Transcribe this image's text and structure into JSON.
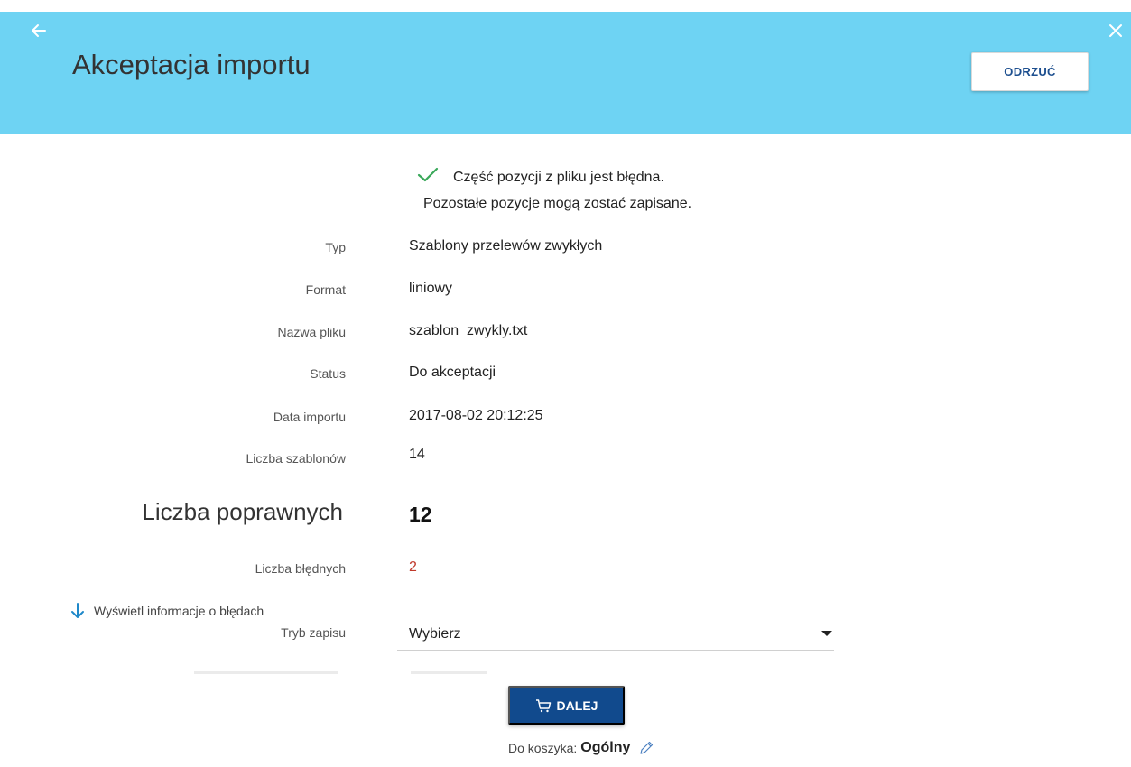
{
  "header": {
    "title": "Akceptacja importu",
    "reject_label": "ODRZUĆ",
    "accent": "#6ed3f3"
  },
  "notice": {
    "line1": "Część pozycji z pliku jest błędna.",
    "line2": "Pozostałe pozycje mogą zostać zapisane.",
    "icon": "check-icon"
  },
  "details": {
    "type_label": "Typ",
    "type_value": "Szablony przelewów zwykłych",
    "format_label": "Format",
    "format_value": "liniowy",
    "file_label": "Nazwa pliku",
    "file_value": "szablon_zwykly.txt",
    "status_label": "Status",
    "status_value": "Do akceptacji",
    "date_label": "Data importu",
    "date_value": "2017-08-02 20:12:25",
    "templates_label": "Liczba szablonów",
    "templates_value": "14",
    "correct_label": "Liczba poprawnych",
    "correct_value": "12",
    "errors_label": "Liczba błędnych",
    "errors_value": "2"
  },
  "errors_link": "Wyświetl informacje o błędach",
  "save_mode": {
    "label": "Tryb zapisu",
    "value": "Wybierz"
  },
  "next_label": "DALEJ",
  "basket": {
    "label": "Do koszyka:",
    "value": "Ogólny"
  },
  "colors": {
    "primary": "#114a8d",
    "error": "#c0392b",
    "success": "#3aa85a"
  }
}
